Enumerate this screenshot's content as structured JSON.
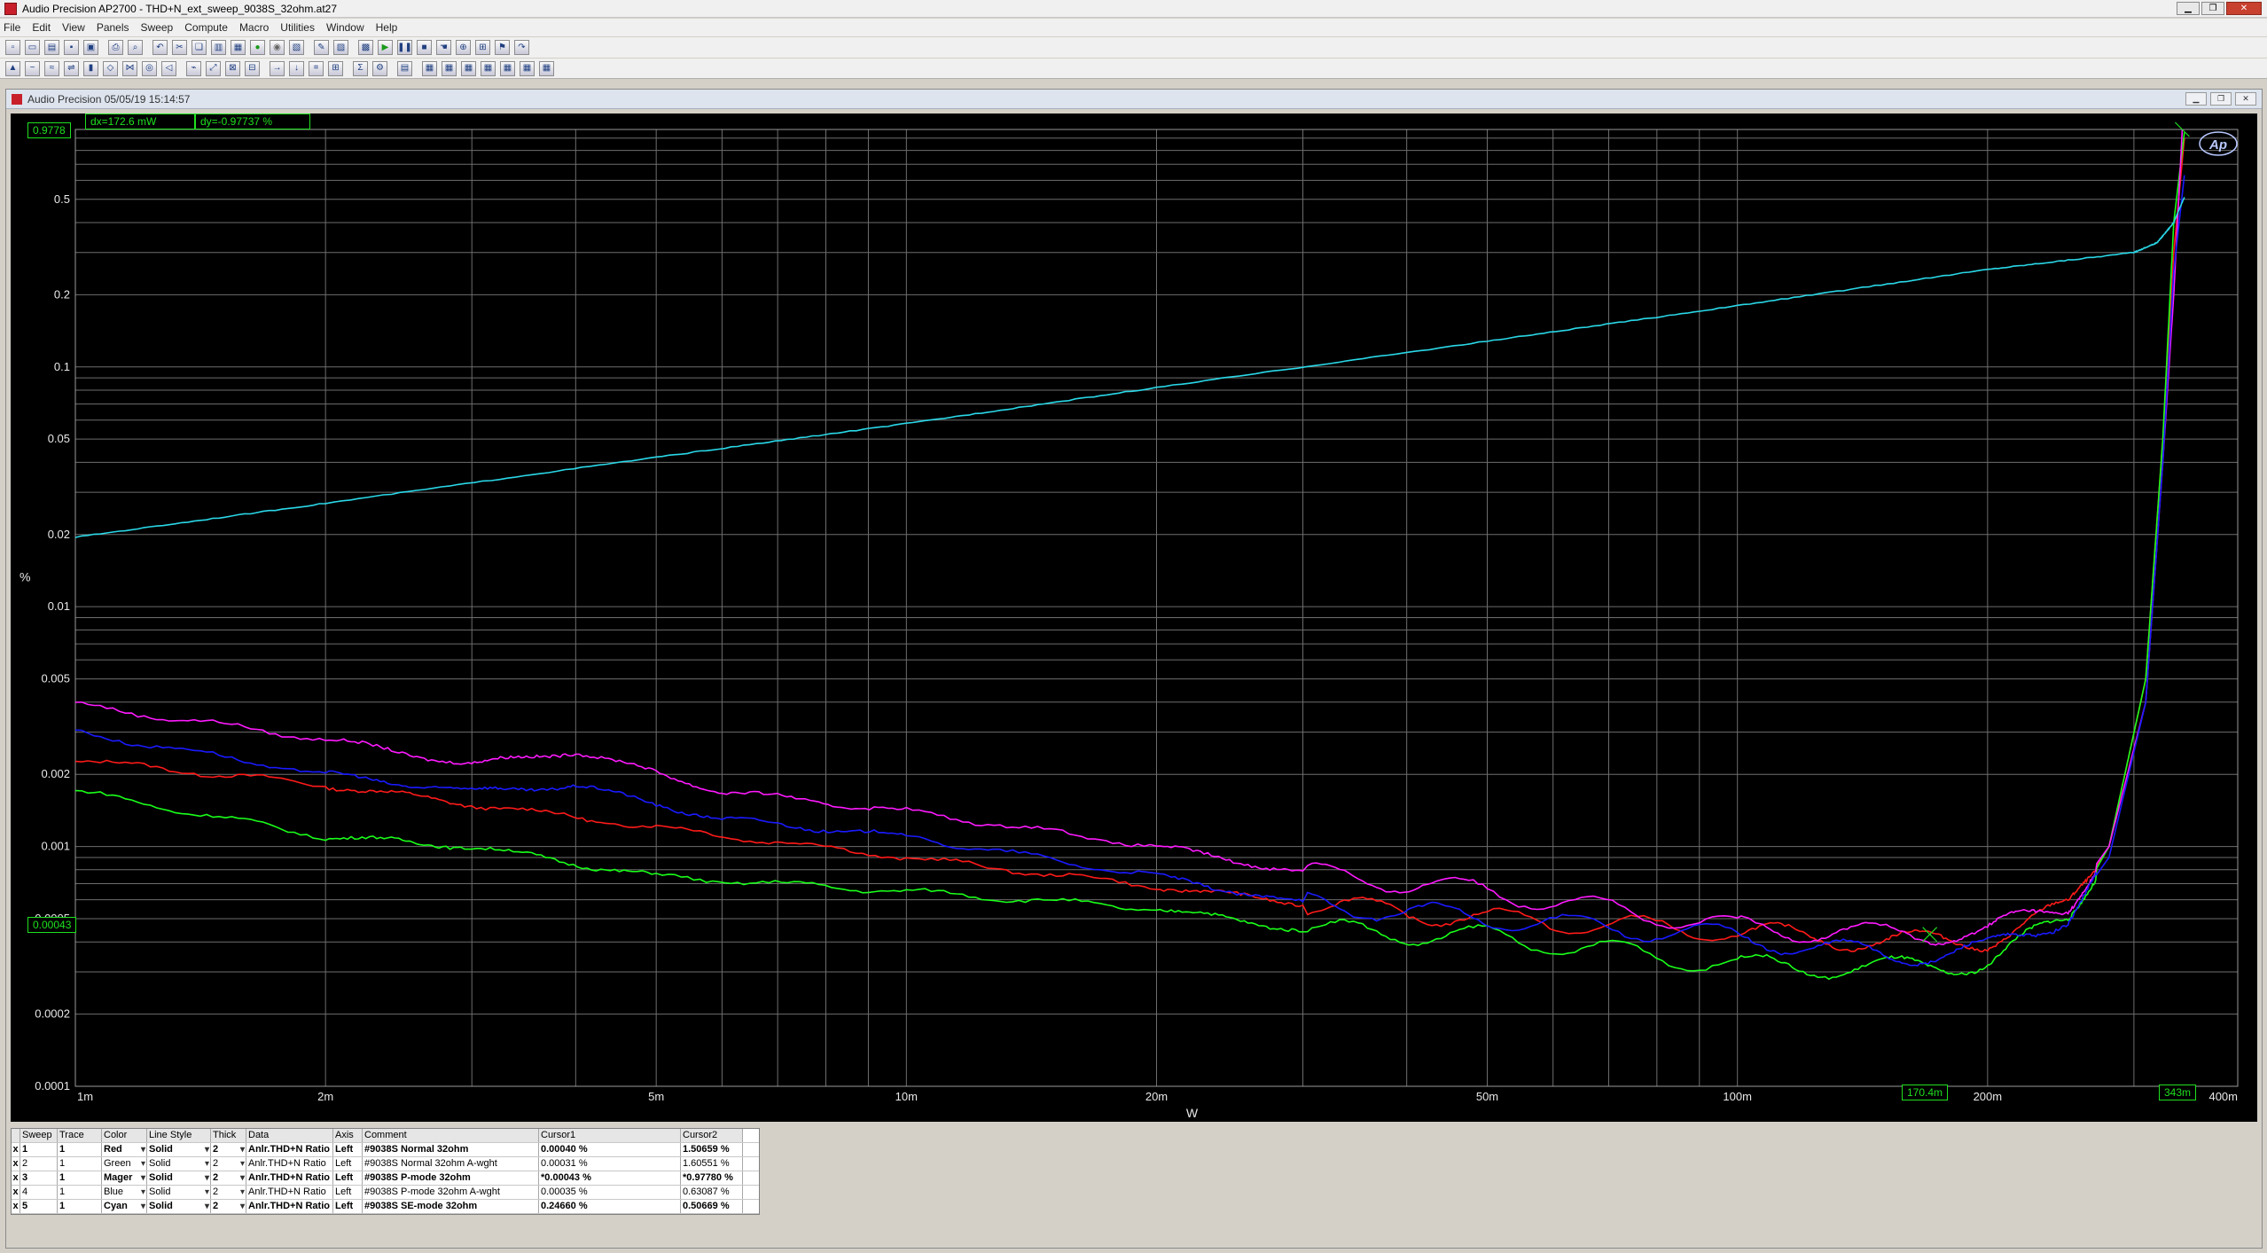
{
  "window": {
    "title": "Audio Precision AP2700 - THD+N_ext_sweep_9038S_32ohm.at27"
  },
  "menu": [
    "File",
    "Edit",
    "View",
    "Panels",
    "Sweep",
    "Compute",
    "Macro",
    "Utilities",
    "Window",
    "Help"
  ],
  "subwindow": {
    "title": "Audio Precision  05/05/19 15:14:57"
  },
  "readouts": {
    "y_value": "0.9778",
    "dx": "dx=172.6  mW",
    "dy": "dy=-0.97737 %",
    "cursor1_y": "0.00043",
    "cursor1_x": "170.4m",
    "cursor2_x": "343m",
    "logo": "Ap"
  },
  "table": {
    "headers": [
      "Sweep",
      "Trace",
      "Color",
      "Line Style",
      "Thick",
      "Data",
      "Axis",
      "Comment",
      "Cursor1",
      "Cursor2"
    ],
    "rows": [
      {
        "check": "x",
        "sweep": "1",
        "trace": "1",
        "color": "Red",
        "style": "Solid",
        "thick": "2",
        "data": "Anlr.THD+N Ratio",
        "axis": "Left",
        "comment": "#9038S Normal 32ohm",
        "c1": "0.00040  %",
        "c2": "1.50659  %",
        "bold": true
      },
      {
        "check": "x",
        "sweep": "2",
        "trace": "1",
        "color": "Green",
        "style": "Solid",
        "thick": "2",
        "data": "Anlr.THD+N Ratio",
        "axis": "Left",
        "comment": "#9038S Normal 32ohm A-wght",
        "c1": "0.00031  %",
        "c2": "1.60551  %",
        "bold": false
      },
      {
        "check": "x",
        "sweep": "3",
        "trace": "1",
        "color": "Mager",
        "style": "Solid",
        "thick": "2",
        "data": "Anlr.THD+N Ratio",
        "axis": "Left",
        "comment": "#9038S P-mode 32ohm",
        "c1": "*0.00043  %",
        "c2": "*0.97780  %",
        "bold": true
      },
      {
        "check": "x",
        "sweep": "4",
        "trace": "1",
        "color": "Blue",
        "style": "Solid",
        "thick": "2",
        "data": "Anlr.THD+N Ratio",
        "axis": "Left",
        "comment": "#9038S P-mode 32ohm A-wght",
        "c1": "0.00035  %",
        "c2": "0.63087  %",
        "bold": false
      },
      {
        "check": "x",
        "sweep": "5",
        "trace": "1",
        "color": "Cyan",
        "style": "Solid",
        "thick": "2",
        "data": "Anlr.THD+N Ratio",
        "axis": "Left",
        "comment": "#9038S SE-mode 32ohm",
        "c1": "0.24660  %",
        "c2": "0.50669  %",
        "bold": true
      }
    ]
  },
  "chart_data": {
    "type": "line",
    "xlabel": "W",
    "ylabel": "%",
    "xscale": "log",
    "yscale": "log",
    "xlim": [
      0.001,
      0.4
    ],
    "ylim": [
      0.0001,
      0.9778
    ],
    "x_ticks": [
      {
        "v": 0.001,
        "l": "1m"
      },
      {
        "v": 0.002,
        "l": "2m"
      },
      {
        "v": 0.005,
        "l": "5m"
      },
      {
        "v": 0.01,
        "l": "10m"
      },
      {
        "v": 0.02,
        "l": "20m"
      },
      {
        "v": 0.05,
        "l": "50m"
      },
      {
        "v": 0.1,
        "l": "100m"
      },
      {
        "v": 0.2,
        "l": "200m"
      },
      {
        "v": 0.4,
        "l": "400m"
      }
    ],
    "y_ticks": [
      {
        "v": 0.5,
        "l": "0.5"
      },
      {
        "v": 0.2,
        "l": "0.2"
      },
      {
        "v": 0.1,
        "l": "0.1"
      },
      {
        "v": 0.05,
        "l": "0.05"
      },
      {
        "v": 0.02,
        "l": "0.02"
      },
      {
        "v": 0.01,
        "l": "0.01"
      },
      {
        "v": 0.005,
        "l": "0.005"
      },
      {
        "v": 0.002,
        "l": "0.002"
      },
      {
        "v": 0.001,
        "l": "0.001"
      },
      {
        "v": 0.0005,
        "l": "0.0005"
      },
      {
        "v": 0.0002,
        "l": "0.0002"
      },
      {
        "v": 0.0001,
        "l": "0.0001"
      }
    ],
    "grid": true,
    "series": [
      {
        "color": "#ff1a1a",
        "points": [
          [
            0.001,
            0.0023
          ],
          [
            0.002,
            0.0018
          ],
          [
            0.003,
            0.0015
          ],
          [
            0.005,
            0.0012
          ],
          [
            0.01,
            0.0009
          ],
          [
            0.02,
            0.00068
          ],
          [
            0.03,
            0.00058
          ],
          [
            0.05,
            0.0005
          ],
          [
            0.1,
            0.00044
          ],
          [
            0.15,
            0.0004
          ],
          [
            0.2,
            0.00041
          ],
          [
            0.25,
            0.00055
          ],
          [
            0.28,
            0.001
          ],
          [
            0.31,
            0.005
          ],
          [
            0.325,
            0.05
          ],
          [
            0.335,
            0.3
          ],
          [
            0.345,
            0.9
          ]
        ]
      },
      {
        "color": "#1aff1a",
        "points": [
          [
            0.001,
            0.0017
          ],
          [
            0.002,
            0.0011
          ],
          [
            0.003,
            0.001
          ],
          [
            0.005,
            0.00075
          ],
          [
            0.01,
            0.00065
          ],
          [
            0.02,
            0.00055
          ],
          [
            0.03,
            0.00045
          ],
          [
            0.05,
            0.00042
          ],
          [
            0.1,
            0.00032
          ],
          [
            0.15,
            0.00031
          ],
          [
            0.2,
            0.00033
          ],
          [
            0.25,
            0.0005
          ],
          [
            0.28,
            0.001
          ],
          [
            0.31,
            0.005
          ],
          [
            0.325,
            0.05
          ],
          [
            0.335,
            0.4
          ],
          [
            0.345,
            0.95
          ]
        ]
      },
      {
        "color": "#ff1aff",
        "points": [
          [
            0.001,
            0.0039
          ],
          [
            0.002,
            0.0028
          ],
          [
            0.003,
            0.0022
          ],
          [
            0.004,
            0.0025
          ],
          [
            0.006,
            0.0017
          ],
          [
            0.01,
            0.0014
          ],
          [
            0.02,
            0.001
          ],
          [
            0.03,
            0.00078
          ],
          [
            0.05,
            0.00065
          ],
          [
            0.1,
            0.00046
          ],
          [
            0.15,
            0.00043
          ],
          [
            0.2,
            0.00044
          ],
          [
            0.25,
            0.00058
          ],
          [
            0.28,
            0.001
          ],
          [
            0.31,
            0.004
          ],
          [
            0.325,
            0.04
          ],
          [
            0.335,
            0.2
          ],
          [
            0.343,
            0.9778
          ]
        ]
      },
      {
        "color": "#1a1aff",
        "points": [
          [
            0.001,
            0.003
          ],
          [
            0.002,
            0.002
          ],
          [
            0.003,
            0.0017
          ],
          [
            0.004,
            0.0018
          ],
          [
            0.006,
            0.0013
          ],
          [
            0.01,
            0.0011
          ],
          [
            0.02,
            0.00075
          ],
          [
            0.03,
            0.00058
          ],
          [
            0.05,
            0.0005
          ],
          [
            0.1,
            0.00042
          ],
          [
            0.15,
            0.00035
          ],
          [
            0.2,
            0.00037
          ],
          [
            0.25,
            0.00052
          ],
          [
            0.28,
            0.0009
          ],
          [
            0.31,
            0.004
          ],
          [
            0.325,
            0.04
          ],
          [
            0.335,
            0.25
          ],
          [
            0.345,
            0.63
          ]
        ]
      },
      {
        "color": "#2ad8e8",
        "points": [
          [
            0.001,
            0.0195
          ],
          [
            0.002,
            0.027
          ],
          [
            0.005,
            0.042
          ],
          [
            0.01,
            0.058
          ],
          [
            0.02,
            0.082
          ],
          [
            0.05,
            0.128
          ],
          [
            0.1,
            0.18
          ],
          [
            0.2,
            0.255
          ],
          [
            0.3,
            0.3
          ],
          [
            0.32,
            0.33
          ],
          [
            0.335,
            0.4
          ],
          [
            0.345,
            0.51
          ]
        ]
      }
    ]
  }
}
